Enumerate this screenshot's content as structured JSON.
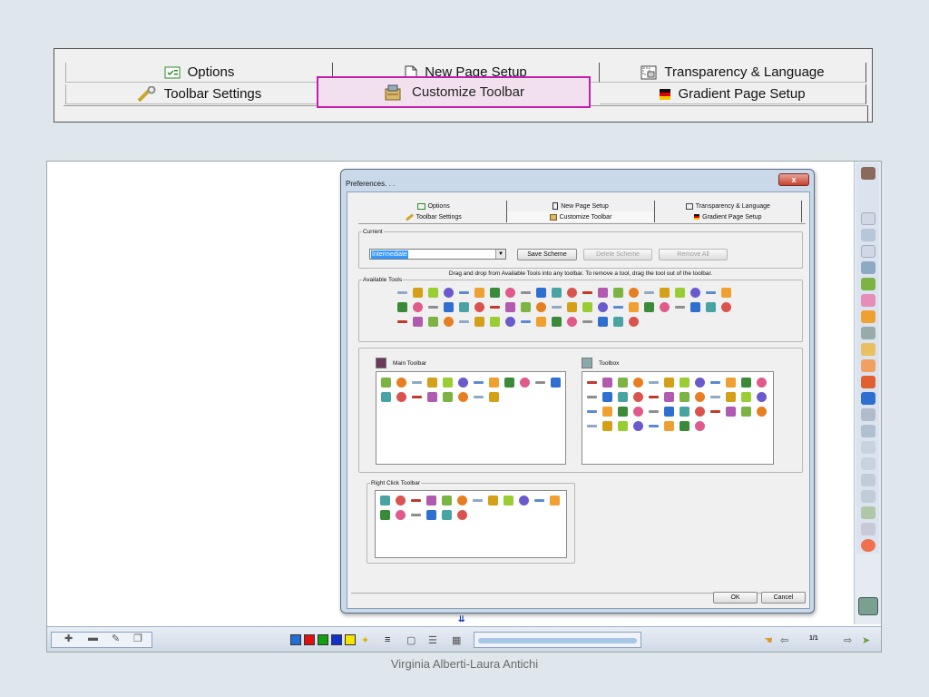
{
  "zoom_tabs": {
    "row1": [
      {
        "label": "Options",
        "icon": "options-icon"
      },
      {
        "label": "New Page Setup",
        "icon": "new-page-icon"
      },
      {
        "label": "Transparency & Language",
        "icon": "transparency-icon"
      }
    ],
    "row2": [
      {
        "label": "Toolbar Settings",
        "icon": "wrench-icon"
      },
      {
        "label": "Customize Toolbar",
        "icon": "customize-toolbar-icon"
      },
      {
        "label": "Gradient Page Setup",
        "icon": "gradient-flag-icon"
      }
    ],
    "highlight_color": "#c21fb2"
  },
  "dialog": {
    "title": "Preferences. . .",
    "close_label": "x",
    "tabs_row1": [
      "Options",
      "New Page Setup",
      "Transparency & Language"
    ],
    "tabs_row2": [
      "Toolbar Settings",
      "Customize Toolbar",
      "Gradient Page Setup"
    ],
    "active_tab": "Customize Toolbar",
    "current": {
      "legend": "Current",
      "selected_scheme": "Intermediate",
      "save_label": "Save Scheme",
      "delete_label": "Delete Scheme",
      "remove_label": "Remove All"
    },
    "drag_hint": "Drag and drop from Available Tools into any toolbar.  To remove a tool, drag the tool out of the toolbar.",
    "available_legend": "Available Tools",
    "main_toolbar_label": "Main Toolbar",
    "toolbox_label": "Toolbox",
    "right_click_legend": "Right Click Toolbar",
    "ok_label": "OK",
    "cancel_label": "Cancel"
  },
  "bottom_bar": {
    "page_indicator": "1/1",
    "pen_colors": [
      "#1f6fd6",
      "#e01010",
      "#10a010",
      "#1030d0",
      "#f5e400"
    ]
  },
  "footer": {
    "credit": "Virginia Alberti-Laura Antichi"
  }
}
